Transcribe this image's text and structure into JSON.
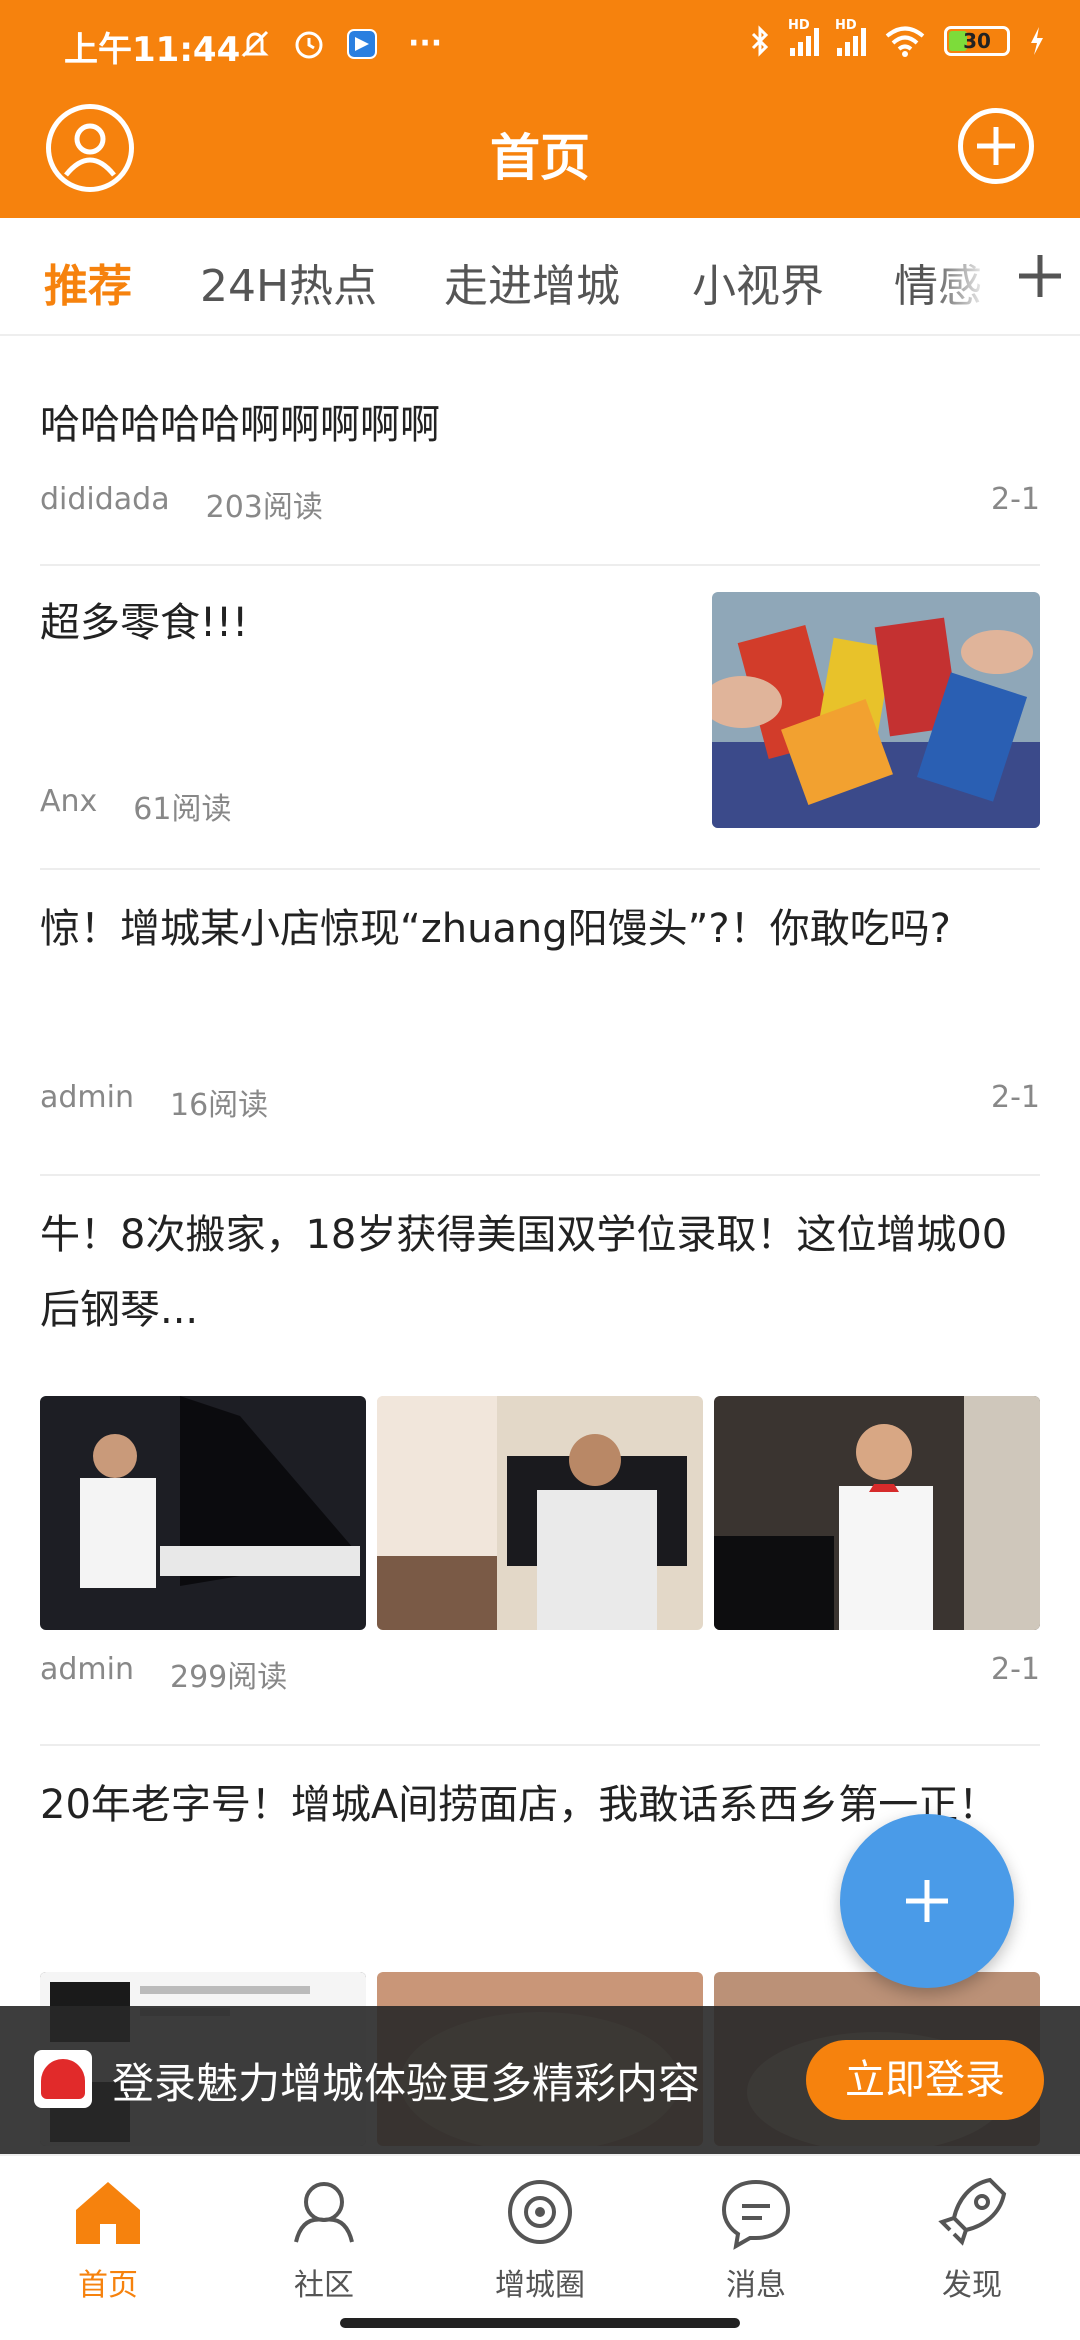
{
  "status_bar": {
    "time": "上午11:44",
    "more": "···",
    "battery": "30",
    "battery_level": 0.3
  },
  "header": {
    "title": "首页"
  },
  "tabs": [
    "推荐",
    "24H热点",
    "走进增城",
    "小视界",
    "情感"
  ],
  "feed": [
    {
      "title": "哈哈哈哈哈啊啊啊啊啊",
      "author": "dididada",
      "reads": "203阅读",
      "date": "2-1"
    },
    {
      "title": "超多零食!!!",
      "author": "Anx",
      "reads": "61阅读"
    },
    {
      "title": "惊！增城某小店惊现“zhuang阳馒头”?！你敢吃吗?",
      "author": "admin",
      "reads": "16阅读",
      "date": "2-1"
    },
    {
      "title": "牛！8次搬家，18岁获得美国双学位录取！这位增城00后钢琴...",
      "author": "admin",
      "reads": "299阅读",
      "date": "2-1"
    },
    {
      "title": "20年老字号！增城A间捞面店，我敢话系西乡第一正！"
    }
  ],
  "login_banner": {
    "text": "登录魅力增城体验更多精彩内容",
    "button": "立即登录"
  },
  "bottom_nav": [
    {
      "label": "首页",
      "icon": "home-icon"
    },
    {
      "label": "社区",
      "icon": "community-icon"
    },
    {
      "label": "增城圈",
      "icon": "circle-icon"
    },
    {
      "label": "消息",
      "icon": "message-icon"
    },
    {
      "label": "发现",
      "icon": "rocket-icon"
    }
  ],
  "colors": {
    "primary": "#F6820D",
    "fab": "#4A9BE8"
  }
}
